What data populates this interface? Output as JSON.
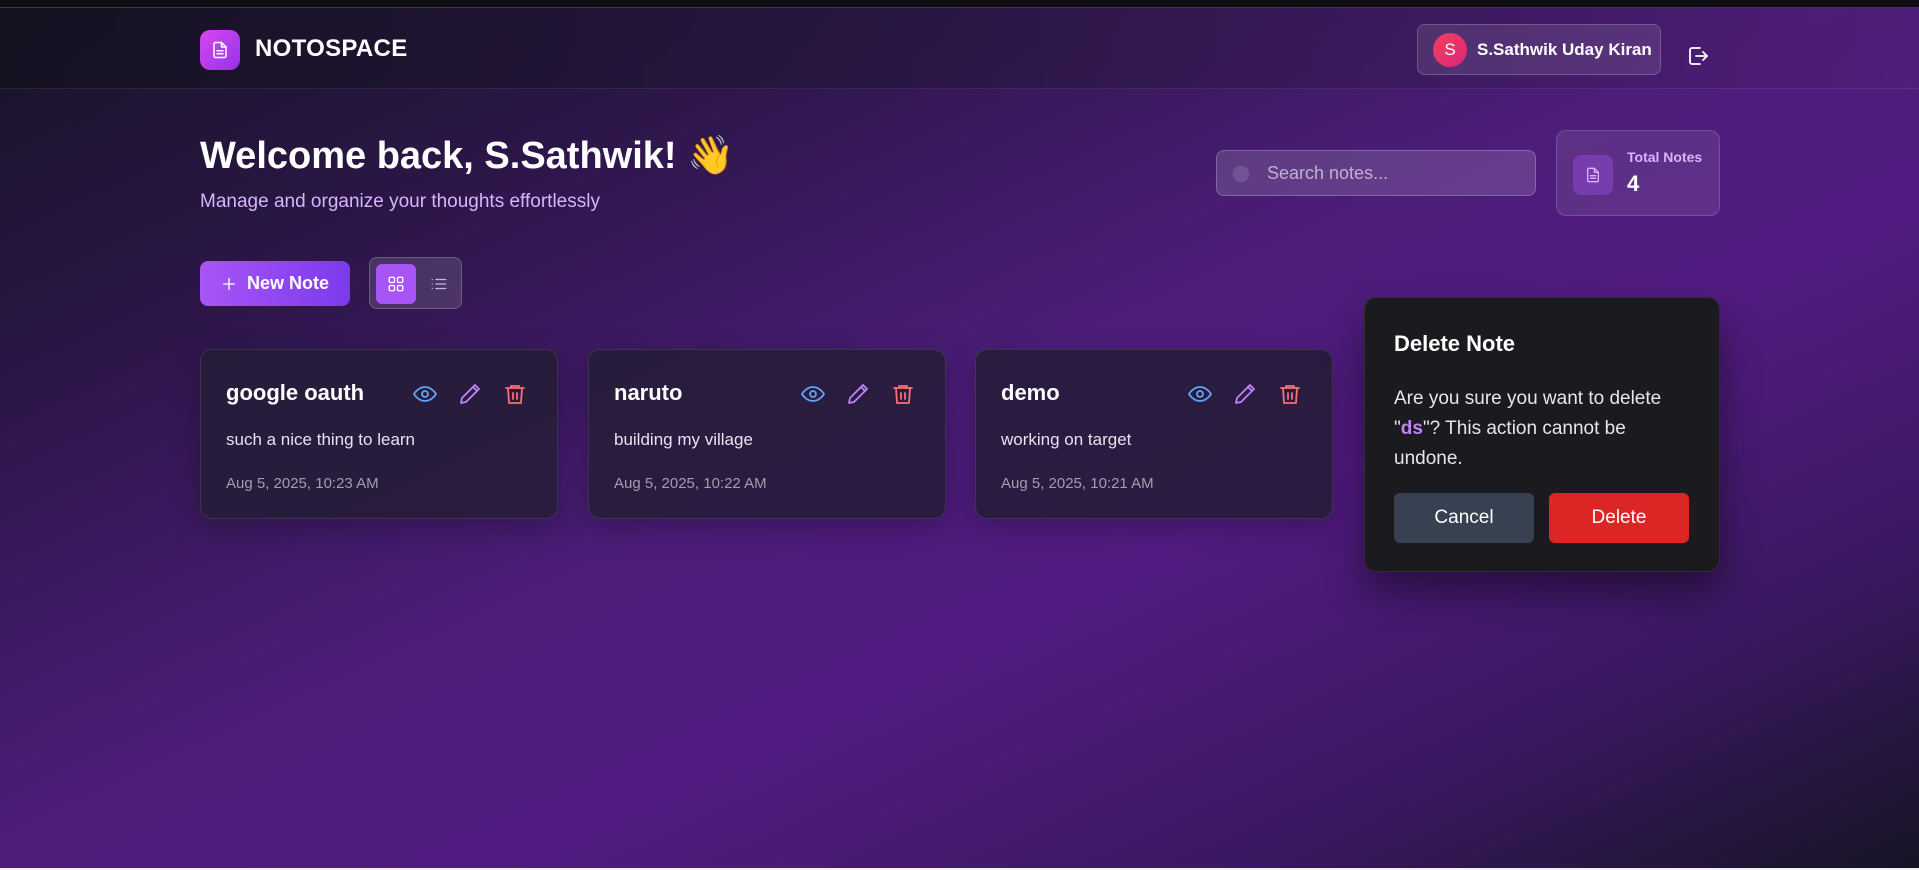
{
  "header": {
    "brand": "NOTOSPACE",
    "user": {
      "initial": "S",
      "name": "S.Sathwik Uday Kiran"
    }
  },
  "welcome": {
    "title": "Welcome back, S.Sathwik! 👋",
    "subtitle": "Manage and organize your thoughts effortlessly"
  },
  "search": {
    "placeholder": "Search notes..."
  },
  "stats": {
    "label": "Total Notes",
    "value": "4"
  },
  "toolbar": {
    "new_note_label": "New Note",
    "active_view": "grid"
  },
  "notes": [
    {
      "title": "google oauth",
      "content": "such a nice thing to learn",
      "date": "Aug 5, 2025, 10:23 AM"
    },
    {
      "title": "naruto",
      "content": "building my village",
      "date": "Aug 5, 2025, 10:22 AM"
    },
    {
      "title": "demo",
      "content": "working on target",
      "date": "Aug 5, 2025, 10:21 AM"
    }
  ],
  "modal": {
    "title": "Delete Note",
    "message_prefix": "Are you sure you want to delete \"",
    "note_name": "ds",
    "message_suffix": "\"? This action cannot be undone.",
    "cancel_label": "Cancel",
    "delete_label": "Delete"
  },
  "colors": {
    "accent": "#a855f7",
    "view_icon": "#60a5fa",
    "edit_icon": "#c084fc",
    "delete_icon": "#f87171",
    "danger": "#dc2626"
  }
}
